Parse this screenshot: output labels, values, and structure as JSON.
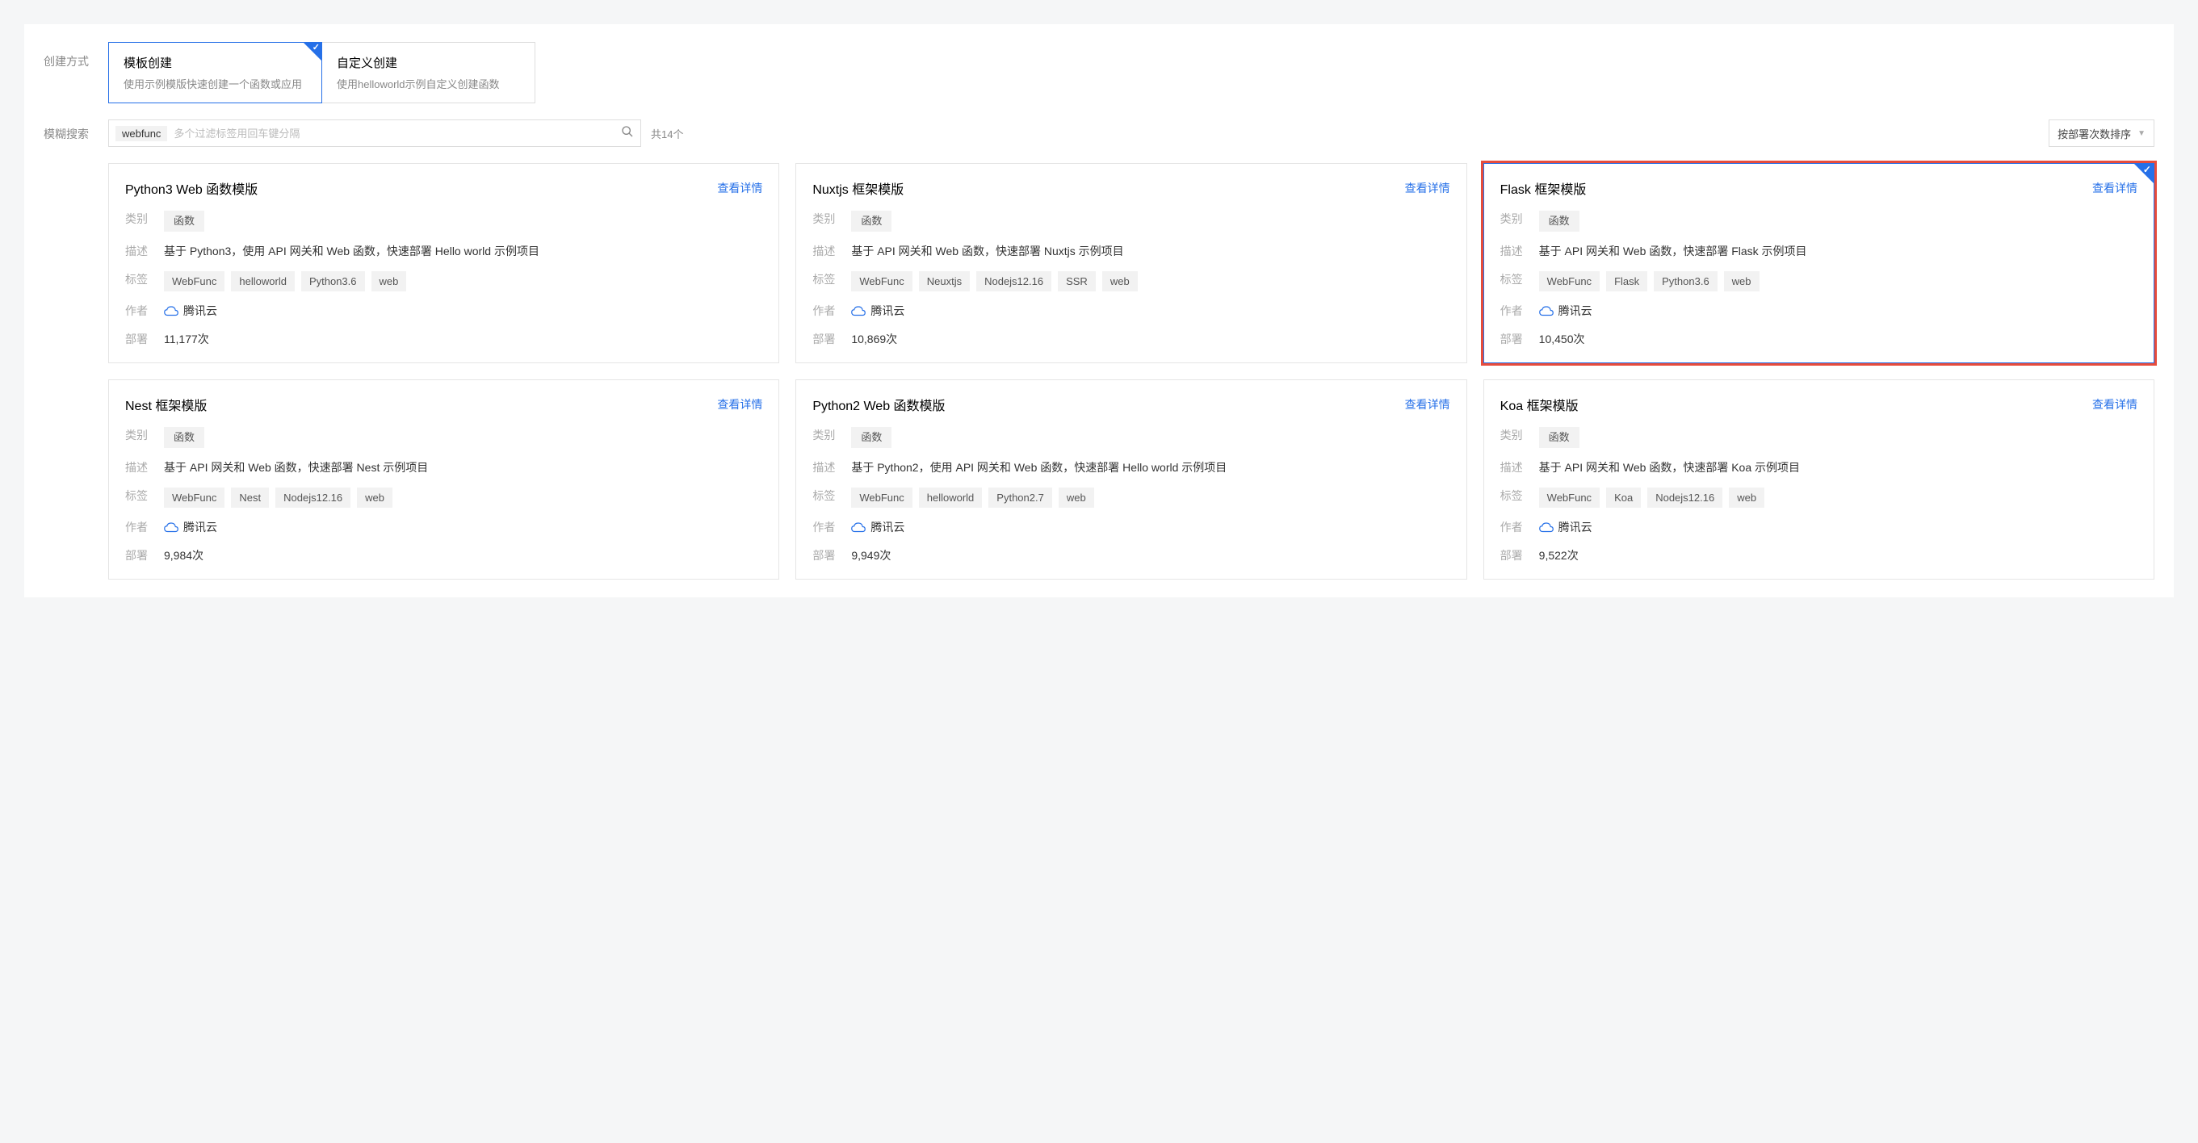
{
  "labels": {
    "create_mode": "创建方式",
    "fuzzy_search": "模糊搜索",
    "detail": "查看详情",
    "category": "类别",
    "description": "描述",
    "tags": "标签",
    "author": "作者",
    "deploy": "部署"
  },
  "modes": [
    {
      "title": "模板创建",
      "desc": "使用示例模版快速创建一个函数或应用",
      "selected": true
    },
    {
      "title": "自定义创建",
      "desc": "使用helloworld示例自定义创建函数",
      "selected": false
    }
  ],
  "search": {
    "tag": "webfunc",
    "placeholder": "多个过滤标签用回车键分隔",
    "count_text": "共14个"
  },
  "sort": {
    "label": "按部署次数排序"
  },
  "author_name": "腾讯云",
  "cards": [
    {
      "title": "Python3 Web 函数模版",
      "category": "函数",
      "desc": "基于 Python3，使用 API 网关和 Web 函数，快速部署 Hello world 示例项目",
      "tags": [
        "WebFunc",
        "helloworld",
        "Python3.6",
        "web"
      ],
      "author": "腾讯云",
      "deploy": "11,177次",
      "selected": false,
      "highlight": false
    },
    {
      "title": "Nuxtjs 框架模版",
      "category": "函数",
      "desc": "基于 API 网关和 Web 函数，快速部署 Nuxtjs 示例项目",
      "tags": [
        "WebFunc",
        "Neuxtjs",
        "Nodejs12.16",
        "SSR",
        "web"
      ],
      "author": "腾讯云",
      "deploy": "10,869次",
      "selected": false,
      "highlight": false
    },
    {
      "title": "Flask 框架模版",
      "category": "函数",
      "desc": "基于 API 网关和 Web 函数，快速部署 Flask 示例项目",
      "tags": [
        "WebFunc",
        "Flask",
        "Python3.6",
        "web"
      ],
      "author": "腾讯云",
      "deploy": "10,450次",
      "selected": true,
      "highlight": true
    },
    {
      "title": "Nest 框架模版",
      "category": "函数",
      "desc": "基于 API 网关和 Web 函数，快速部署 Nest 示例项目",
      "tags": [
        "WebFunc",
        "Nest",
        "Nodejs12.16",
        "web"
      ],
      "author": "腾讯云",
      "deploy": "9,984次",
      "selected": false,
      "highlight": false
    },
    {
      "title": "Python2 Web 函数模版",
      "category": "函数",
      "desc": "基于 Python2，使用 API 网关和 Web 函数，快速部署 Hello world 示例项目",
      "tags": [
        "WebFunc",
        "helloworld",
        "Python2.7",
        "web"
      ],
      "author": "腾讯云",
      "deploy": "9,949次",
      "selected": false,
      "highlight": false
    },
    {
      "title": "Koa 框架模版",
      "category": "函数",
      "desc": "基于 API 网关和 Web 函数，快速部署 Koa 示例项目",
      "tags": [
        "WebFunc",
        "Koa",
        "Nodejs12.16",
        "web"
      ],
      "author": "腾讯云",
      "deploy": "9,522次",
      "selected": false,
      "highlight": false
    }
  ]
}
